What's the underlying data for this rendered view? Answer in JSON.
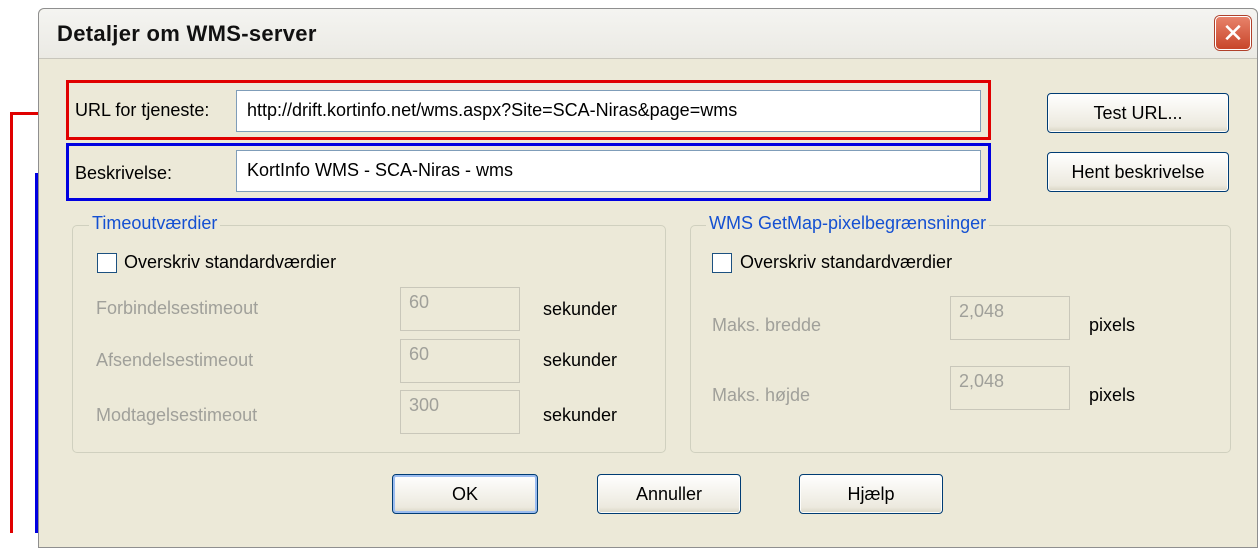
{
  "window": {
    "title": "Detaljer om WMS-server",
    "close_glyph": "✕"
  },
  "url_row": {
    "label": "URL for tjeneste:",
    "value": "http://drift.kortinfo.net/wms.aspx?Site=SCA-Niras&page=wms"
  },
  "desc_row": {
    "label": "Beskrivelse:",
    "value": "KortInfo WMS - SCA-Niras - wms"
  },
  "buttons": {
    "test_url": "Test URL...",
    "fetch_desc": "Hent beskrivelse",
    "ok": "OK",
    "cancel": "Annuller",
    "help": "Hjælp"
  },
  "timeouts": {
    "title": "Timeoutværdier",
    "override_label": "Overskriv standardværdier",
    "override_checked": false,
    "rows": [
      {
        "label": "Forbindelsestimeout",
        "value": "60",
        "unit": "sekunder"
      },
      {
        "label": "Afsendelsestimeout",
        "value": "60",
        "unit": "sekunder"
      },
      {
        "label": "Modtagelsestimeout",
        "value": "300",
        "unit": "sekunder"
      }
    ]
  },
  "pixel_limits": {
    "title": "WMS GetMap-pixelbegrænsninger",
    "override_label": "Overskriv standardværdier",
    "override_checked": false,
    "rows": [
      {
        "label": "Maks. bredde",
        "value": "2,048",
        "unit": "pixels"
      },
      {
        "label": "Maks. højde",
        "value": "2,048",
        "unit": "pixels"
      }
    ]
  },
  "colors": {
    "highlight_url": "#e00000",
    "highlight_desc": "#0000e0",
    "groupbox_title": "#1450d2"
  }
}
